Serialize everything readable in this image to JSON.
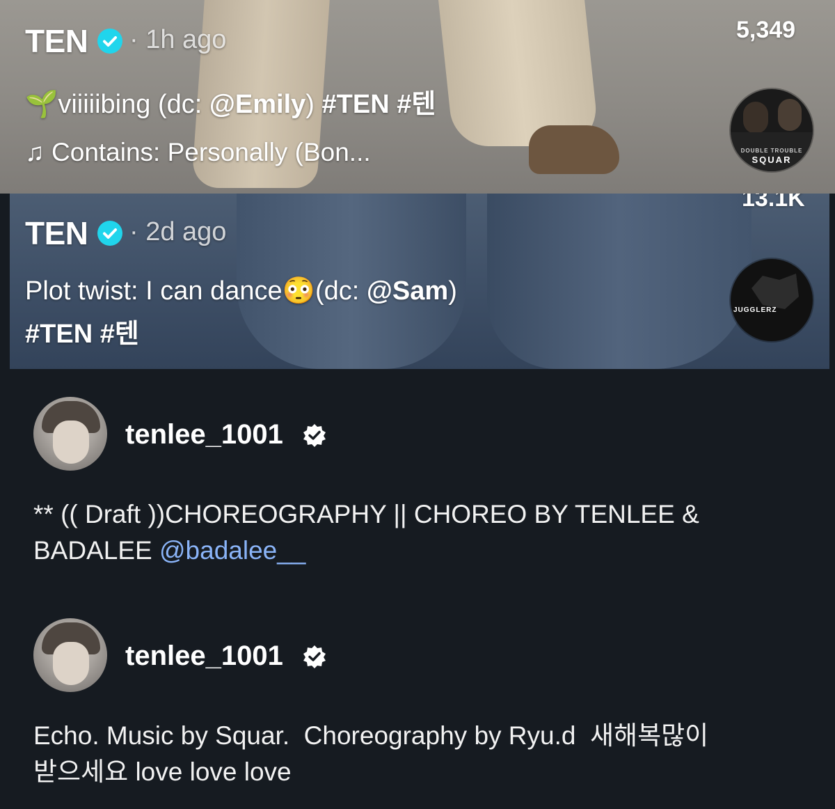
{
  "post1": {
    "username": "TEN",
    "time": "· 1h ago",
    "caption_prefix": "viiiiibing (dc: ",
    "mention": "@Emily",
    "caption_suffix": ") ",
    "hashtags": "#TEN #텐",
    "music_label": "Contains: Personally (Bon...",
    "count": "5,349",
    "disc_text": "SQUAR",
    "disc_text_small": "DOUBLE TROUBLE"
  },
  "post2": {
    "username": "TEN",
    "time": "· 2d ago",
    "caption_prefix": "Plot twist: I can dance",
    "emoji": "😳",
    "caption_mid": "(dc: ",
    "mention": "@Sam",
    "caption_suffix": ")",
    "hashtags": "#TEN #텐",
    "count": "13.1K",
    "disc_text": "JUGGLERZ"
  },
  "post3": {
    "username": "tenlee_1001",
    "caption": "** (( Draft ))CHOREOGRAPHY || CHOREO BY TENLEE &",
    "caption_line2": "BADALEE ",
    "mention": "@badalee__"
  },
  "post4": {
    "username": "tenlee_1001",
    "caption_line1": "Echo. Music by Squar.  Choreography by Ryu.d  새해복많이",
    "caption_line2": "받으세요 love love love"
  },
  "colors": {
    "tiktok_verified": "#20d5ec",
    "ig_link": "#8ab4f8",
    "ig_background": "#161b21"
  },
  "icons": [
    "verified-badge-icon",
    "music-note-icon",
    "sprout-emoji-icon",
    "instagram-verified-badge-icon"
  ]
}
